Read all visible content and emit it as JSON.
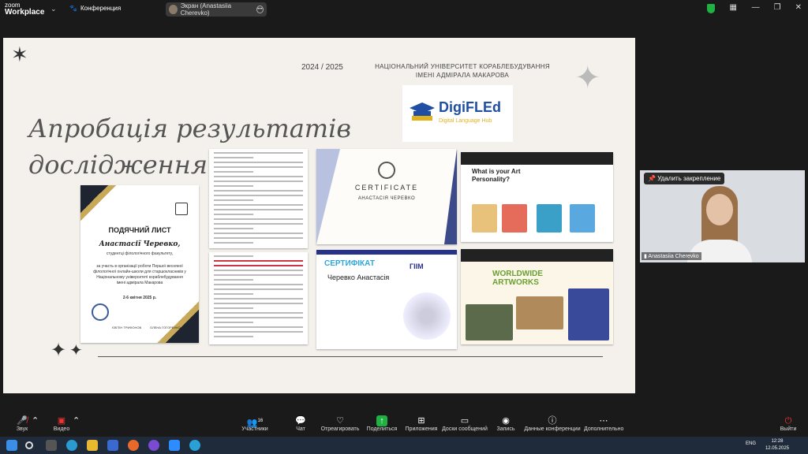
{
  "topbar": {
    "logo_line1": "zoom",
    "logo_line2": "Workplace",
    "chevron": "⌄",
    "conference_label": "Конференция",
    "screen_share_label": "Экран (Anastasiia Cherevko)",
    "icons": [
      "paw-icon",
      "more-icon",
      "shield-icon",
      "grid-icon"
    ]
  },
  "slide": {
    "year": "2024 / 2025",
    "university_line1": "НАЦІОНАЛЬНИЙ УНІВЕРСИТЕТ КОРАБЛЕБУДУВАННЯ",
    "university_line2": "ІМЕНІ АДМІРАЛА МАКАРОВА",
    "title_line1": "Апробація результатів",
    "title_line2": "дослідження",
    "digi_title": "DigiFLEd",
    "digi_subtitle": "Digital Language Hub",
    "letter": {
      "heading": "ПОДЯЧНИЙ ЛИСТ",
      "name": "Анастасії Черевко,",
      "subtitle": "студентці філологічного факультету,",
      "body": "за участь в організації роботи Першої весняної філологічної онлайн-школи для старшокласників у Національному університеті кораблебудування імені адмірала Макарова",
      "date": "2-6 квітня 2025 р.",
      "sig1": "ЄВГЕН ТРИФОНОВ",
      "sig2": "ОЛЕНА ГОГОРЕНКО"
    },
    "certificate": {
      "title": "CERTIFICATE",
      "name": "АНАСТАСІЯ ЧЕРЕВКО"
    },
    "certificate2": {
      "title": "СЕРТИФІКАТ",
      "name": "Черевко Анастасія",
      "logo": "ГIIM"
    },
    "screenshot1_question": "What is your Art Personality?",
    "screenshot2_heading": "WORLDWIDE ARTWORKS"
  },
  "camera": {
    "unpin_label": "Удалить закрепление",
    "participant_name": "Anastasiia Cherevko"
  },
  "toolbar": {
    "audio": "Звук",
    "video": "Видео",
    "participants": "Участники",
    "participants_count": "16",
    "chat": "Чат",
    "react": "Отреагировать",
    "share": "Поделиться",
    "apps": "Приложения",
    "whiteboards": "Доски сообщений",
    "record": "Запись",
    "info": "Данные конференции",
    "more": "Дополнительно",
    "leave": "Выйти"
  },
  "taskbar": {
    "lang": "ENG",
    "time": "12:28",
    "date": "12.05.2025"
  },
  "colors": {
    "accent_green": "#1fb141",
    "mute_red": "#e33333",
    "digi_blue": "#1f4ea3",
    "digi_yellow": "#e2b21d"
  }
}
